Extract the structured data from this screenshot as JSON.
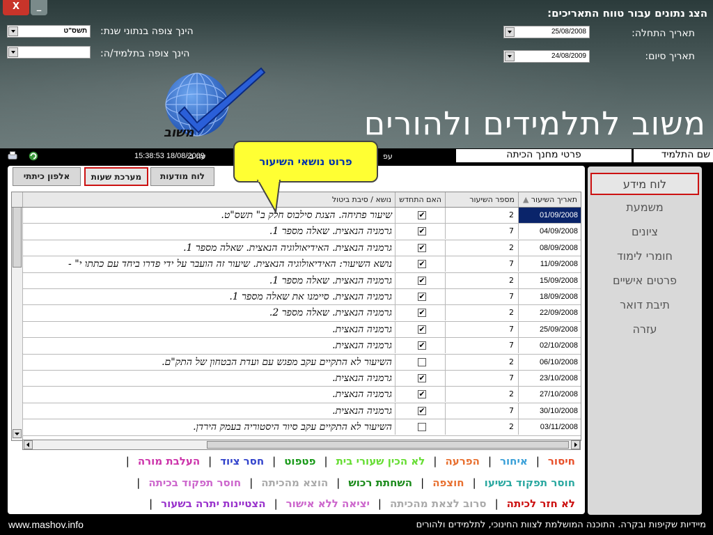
{
  "header": {
    "title": "הצג נתונים עבור טווח התאריכים:",
    "start_date_label": "תאריך התחלה:",
    "start_date_value": "25/08/2008",
    "end_date_label": "תאריך סיום:",
    "end_date_value": "24/08/2009",
    "year_label": "הינך צופה בנתוני שנת:",
    "year_value": "תשס\"ט",
    "student_view_label": "הינך צופה בתלמיד/ה:",
    "student_view_value": "",
    "brand": "משוב לתלמידים ולהורים",
    "close_label": "X",
    "minimize_label": "_"
  },
  "status": {
    "student_name_label": "שם התלמיד",
    "class_teacher_label": "פרטי מחנך הכיתה",
    "timestamp": "15:38:53 18/08/2009",
    "timestamp_prefix": "עה ב:",
    "timestamp_left_fragment": "עפ"
  },
  "callout": {
    "text": "פרוט נושאי השיעור"
  },
  "tabs": [
    {
      "label": "לוח מודעות",
      "active": false
    },
    {
      "label": "מערכת שעות",
      "active": true
    },
    {
      "label": "אלפון כיתתי",
      "active": false
    }
  ],
  "grid": {
    "headers": {
      "date": "תאריך השיעור",
      "lesson_number": "מספר השיעור",
      "renewed": "האם התחדש",
      "topic": "נושא / סיבת ביטול"
    },
    "rows": [
      {
        "date": "01/09/2008",
        "num": "2",
        "checked": true,
        "topic": "שיעור פתיחה. הצגת סילבוס חלק ב\" תשס\"ט."
      },
      {
        "date": "04/09/2008",
        "num": "7",
        "checked": true,
        "topic": "גרמניה הנאצית. שאלה מספר 1."
      },
      {
        "date": "08/09/2008",
        "num": "2",
        "checked": true,
        "topic": "גרמניה הנאצית. האידיאולוגיה הנאצית. שאלה מספר 1."
      },
      {
        "date": "11/09/2008",
        "num": "7",
        "checked": true,
        "topic": "נושא השיעור: האידיאולוגיה הנאצית. שיעור זה הועבר על ידי פדרו ביחד עם כתתו י\" -"
      },
      {
        "date": "15/09/2008",
        "num": "2",
        "checked": true,
        "topic": "גרמניה הנאצית. שאלה מספר 1."
      },
      {
        "date": "18/09/2008",
        "num": "7",
        "checked": true,
        "topic": "גרמניה הנאצית. סיימנו את שאלה מספר 1."
      },
      {
        "date": "22/09/2008",
        "num": "2",
        "checked": true,
        "topic": "גרמניה הנאצית. שאלה מספר 2."
      },
      {
        "date": "25/09/2008",
        "num": "7",
        "checked": true,
        "topic": "גרמניה הנאצית."
      },
      {
        "date": "02/10/2008",
        "num": "7",
        "checked": true,
        "topic": "גרמניה הנאצית."
      },
      {
        "date": "06/10/2008",
        "num": "2",
        "checked": false,
        "topic": "השיעור לא התקיים עקב מפגש עם ועדת הבטחון של התק\"ם."
      },
      {
        "date": "23/10/2008",
        "num": "7",
        "checked": true,
        "topic": "גרמניה הנאצית."
      },
      {
        "date": "27/10/2008",
        "num": "2",
        "checked": true,
        "topic": "גרמניה הנאצית."
      },
      {
        "date": "30/10/2008",
        "num": "7",
        "checked": true,
        "topic": "גרמניה הנאצית."
      },
      {
        "date": "03/11/2008",
        "num": "2",
        "checked": false,
        "topic": "השיעור לא התקיים עקב סיור היסטוריה בעמק הירדן."
      }
    ]
  },
  "legend": {
    "line1": [
      {
        "label": "חיסור",
        "color": "#e8502a"
      },
      {
        "label": "איחור",
        "color": "#3aa0d8"
      },
      {
        "label": "הפרעה",
        "color": "#e87030"
      },
      {
        "label": "לא הכין שעורי בית",
        "color": "#66dd33"
      },
      {
        "label": "פטפוט",
        "color": "#1a9a1a"
      },
      {
        "label": "חסר ציוד",
        "color": "#3344cc"
      },
      {
        "label": "העלבת מורה",
        "color": "#cc33aa"
      }
    ],
    "line2": [
      {
        "label": "חוסר תפקוד בשיעו",
        "color": "#2aa8a0"
      },
      {
        "label": "חוצפה",
        "color": "#e87030"
      },
      {
        "label": "השחתת רכוש",
        "color": "#1a8a1a"
      },
      {
        "label": "הוצא מהכיתה",
        "color": "#aaaaaa"
      },
      {
        "label": "חוסר תפקוד בכיתה",
        "color": "#cc66cc"
      }
    ],
    "line3": [
      {
        "label": "לא חזר לכיתה",
        "color": "#cc1111"
      },
      {
        "label": "סרוב לצאת מהכיתה",
        "color": "#aaaaaa"
      },
      {
        "label": "יציאה ללא אישור",
        "color": "#cc66cc"
      },
      {
        "label": "הצטיינות יתרה בשעור",
        "color": "#9933cc"
      }
    ]
  },
  "sidebar": {
    "items": [
      {
        "label": "לוח מידע",
        "active": true
      },
      {
        "label": "משמעת",
        "active": false
      },
      {
        "label": "ציונים",
        "active": false
      },
      {
        "label": "חומרי לימוד",
        "active": false
      },
      {
        "label": "פרטים אישיים",
        "active": false
      },
      {
        "label": "תיבת דואר",
        "active": false
      },
      {
        "label": "עזרה",
        "active": false
      }
    ]
  },
  "footer": {
    "url": "www.mashov.info",
    "text": "מיידיות שקיפות ובקרה. התוכנה המושלמת לצוות החינוכי, לתלמידים ולהורים"
  }
}
